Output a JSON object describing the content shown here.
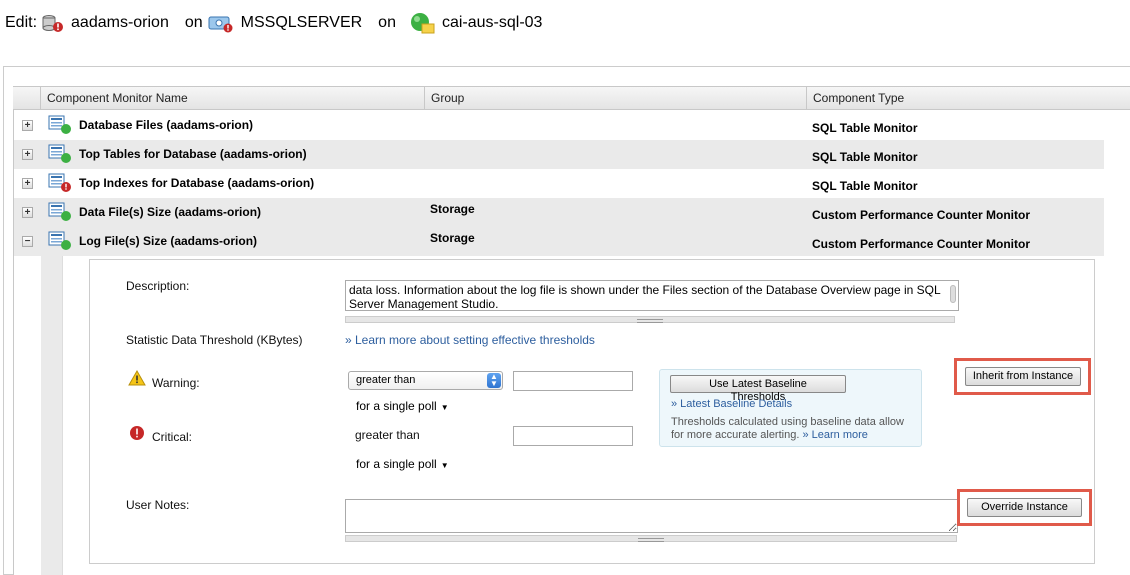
{
  "header": {
    "edit_label": "Edit:",
    "app_name": "aadams-orion",
    "on1": "on",
    "instance": "MSSQLSERVER",
    "on2": "on",
    "server": "cai-aus-sql-03"
  },
  "grid": {
    "columns": [
      "Component Monitor Name",
      "Group",
      "Component Type"
    ],
    "rows": [
      {
        "expand": "+",
        "name": "Database Files (aadams-orion)",
        "group": "",
        "type": "SQL Table Monitor",
        "status": "up"
      },
      {
        "expand": "+",
        "name": "Top Tables for Database (aadams-orion)",
        "group": "",
        "type": "SQL Table Monitor",
        "status": "up"
      },
      {
        "expand": "+",
        "name": "Top Indexes for Database (aadams-orion)",
        "group": "",
        "type": "SQL Table Monitor",
        "status": "critical"
      },
      {
        "expand": "+",
        "name": "Data File(s) Size (aadams-orion)",
        "group": "Storage",
        "type": "Custom Performance Counter Monitor",
        "status": "up"
      },
      {
        "expand": "−",
        "name": "Log File(s) Size (aadams-orion)",
        "group": "Storage",
        "type": "Custom Performance Counter Monitor",
        "status": "up"
      }
    ]
  },
  "detail": {
    "description_label": "Description:",
    "description_text": "data loss. Information about the log file is shown under the Files section of the Database Overview page in SQL Server Management Studio.",
    "threshold_label": "Statistic Data Threshold (KBytes)",
    "learn_thresholds": "» Learn more about setting effective thresholds",
    "warning_label": "Warning:",
    "warning_operator": "greater than",
    "warning_value": "",
    "warning_poll": "for a single poll",
    "critical_label": "Critical:",
    "critical_operator": "greater than",
    "critical_value": "",
    "critical_poll": "for a single poll",
    "baseline_button": "Use Latest Baseline Thresholds",
    "baseline_details": "» Latest Baseline Details",
    "baseline_info": "Thresholds calculated using baseline data allow for more accurate alerting.",
    "baseline_learn": "» Learn more",
    "inherit_button": "Inherit from Instance",
    "user_notes_label": "User Notes:",
    "override_button": "Override Instance"
  },
  "colors": {
    "highlight": "#e05a4a",
    "link": "#2d5e9e",
    "status_up": "#3cb043",
    "status_critical": "#c62828"
  }
}
